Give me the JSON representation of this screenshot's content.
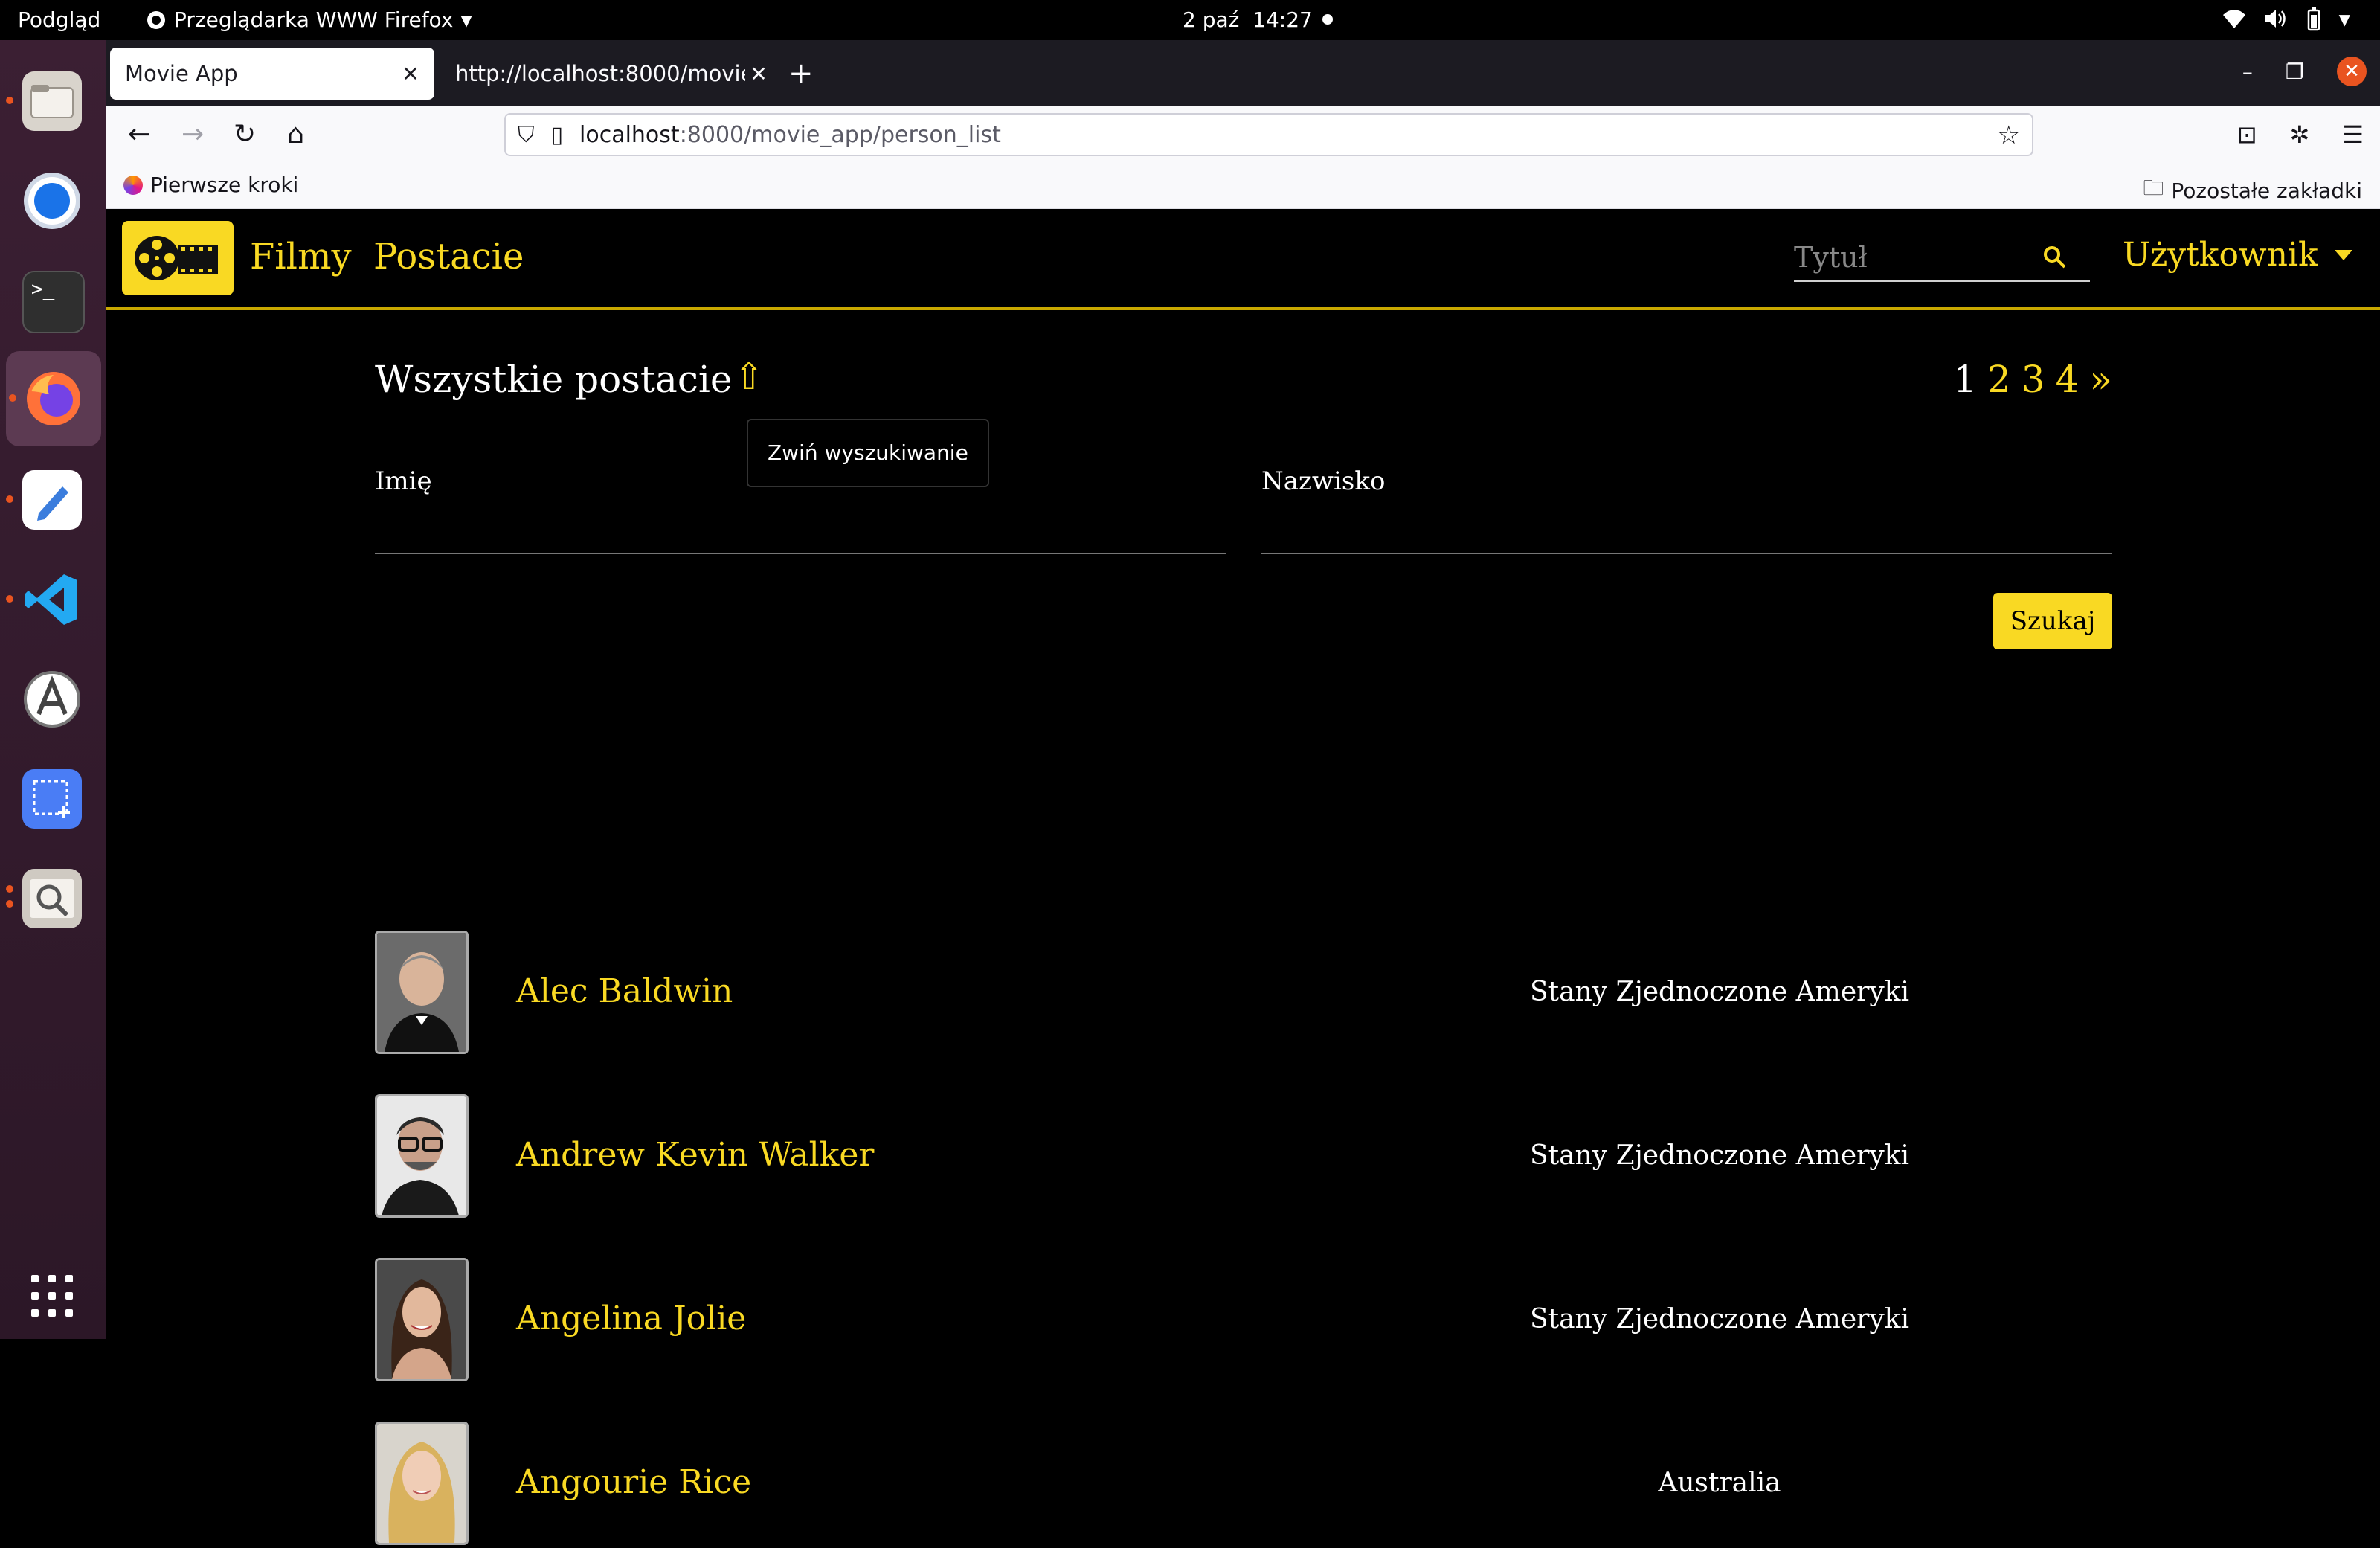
{
  "system_bar": {
    "left_label": "Podgląd",
    "app_name": "Przeglądarka WWW Firefox",
    "date": "2 paź",
    "time": "14:27"
  },
  "browser": {
    "tabs": [
      {
        "title": "Movie App",
        "active": true
      },
      {
        "title": "http://localhost:8000/movie_",
        "active": false
      }
    ],
    "url_host": "localhost",
    "url_path": ":8000/movie_app/person_list",
    "bookmarks": {
      "first": "Pierwsze kroki",
      "other": "Pozostałe zakładki"
    }
  },
  "site": {
    "nav": [
      "Filmy",
      "Postacie"
    ],
    "search_placeholder": "Tytuł",
    "user_menu": "Użytkownik"
  },
  "main": {
    "title": "Wszystkie postacie",
    "collapse_arrow": "⇧",
    "tooltip": "Zwiń wyszukiwanie",
    "pagination": {
      "current": "1",
      "pages": [
        "2",
        "3",
        "4"
      ],
      "next": "»"
    },
    "filters": {
      "first_name_label": "Imię",
      "last_name_label": "Nazwisko"
    },
    "search_button": "Szukaj",
    "people": [
      {
        "name": "Alec Baldwin",
        "country": "Stany Zjednoczone Ameryki"
      },
      {
        "name": "Andrew Kevin Walker",
        "country": "Stany Zjednoczone Ameryki"
      },
      {
        "name": "Angelina Jolie",
        "country": "Stany Zjednoczone Ameryki"
      },
      {
        "name": "Angourie Rice",
        "country": "Australia"
      }
    ]
  },
  "colors": {
    "accent": "#f9d923",
    "background": "#000000",
    "dock": "#2c1727",
    "ubuntu_orange": "#e95420"
  }
}
